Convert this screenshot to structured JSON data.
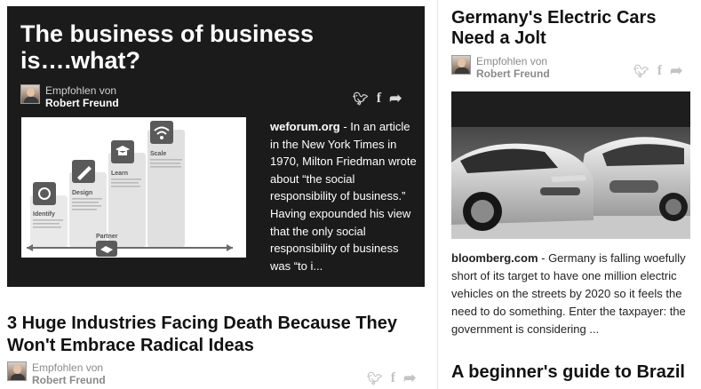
{
  "recommended_label": "Empfohlen von",
  "recommender_name": "Robert Freund",
  "icons": {
    "twitter": "twitter-bird-icon",
    "facebook": "facebook-f-icon",
    "share": "share-arrow-icon"
  },
  "colors": {
    "feature_background": "#1b1b1b",
    "text_dark": "#111111",
    "muted": "#8a8a8a"
  },
  "articles": [
    {
      "title": "The business of business is….what?",
      "source": "weforum.org",
      "excerpt": " - In an article in the New York Times in 1970, Milton Friedman wrote about “the social responsibility of business.” Having expounded his view that the only social responsibility of business was “to i...",
      "diagram": {
        "stages": [
          "Identify",
          "Design",
          "Learn",
          "Scale"
        ],
        "partner": "Partner"
      }
    },
    {
      "title": "3 Huge Industries Facing Death Because They Won't Embrace Radical Ideas"
    },
    {
      "title": "Germany's Electric Cars Need a Jolt",
      "source": "bloomberg.com",
      "excerpt": " - Germany is falling woefully short of its target to have one million electric vehicles on the streets by 2020 so it feels the need to do something. Enter the taxpayer: the government is considering ..."
    },
    {
      "title": "A beginner's guide to Brazil"
    }
  ]
}
